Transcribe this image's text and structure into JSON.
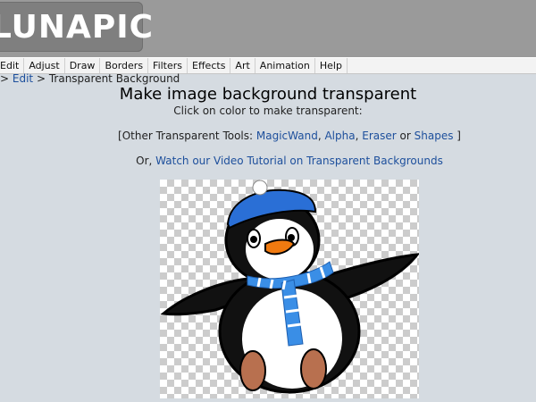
{
  "app": {
    "logo_text": "LUNAPIC"
  },
  "menu": [
    "Edit",
    "Adjust",
    "Draw",
    "Borders",
    "Filters",
    "Effects",
    "Art",
    "Animation",
    "Help"
  ],
  "breadcrumb": {
    "prefix": ">",
    "link": "Edit",
    "current": "> Transparent Background"
  },
  "page": {
    "title": "Make image background transparent",
    "subtitle": "Click on color to make transparent:"
  },
  "tools": {
    "prefix": "[Other Transparent Tools:",
    "links": [
      "MagicWand",
      "Alpha",
      "Eraser",
      "Shapes"
    ],
    "sep1": ",",
    "sep2": ",",
    "sep3": "or",
    "suffix": "]"
  },
  "video": {
    "prefix": "Or,",
    "link": "Watch our Video Tutorial on Transparent Backgrounds"
  },
  "colors": {
    "header_bg": "#9a9a9a",
    "link": "#1d4f9c",
    "page_bg": "#d5dbe1",
    "hat_blue": "#2a6fd6",
    "scarf_blue": "#3a8ee6",
    "beak_orange": "#f07a10",
    "feet_brown": "#b8704f"
  },
  "image": {
    "subject_icon": "penguin-image"
  }
}
